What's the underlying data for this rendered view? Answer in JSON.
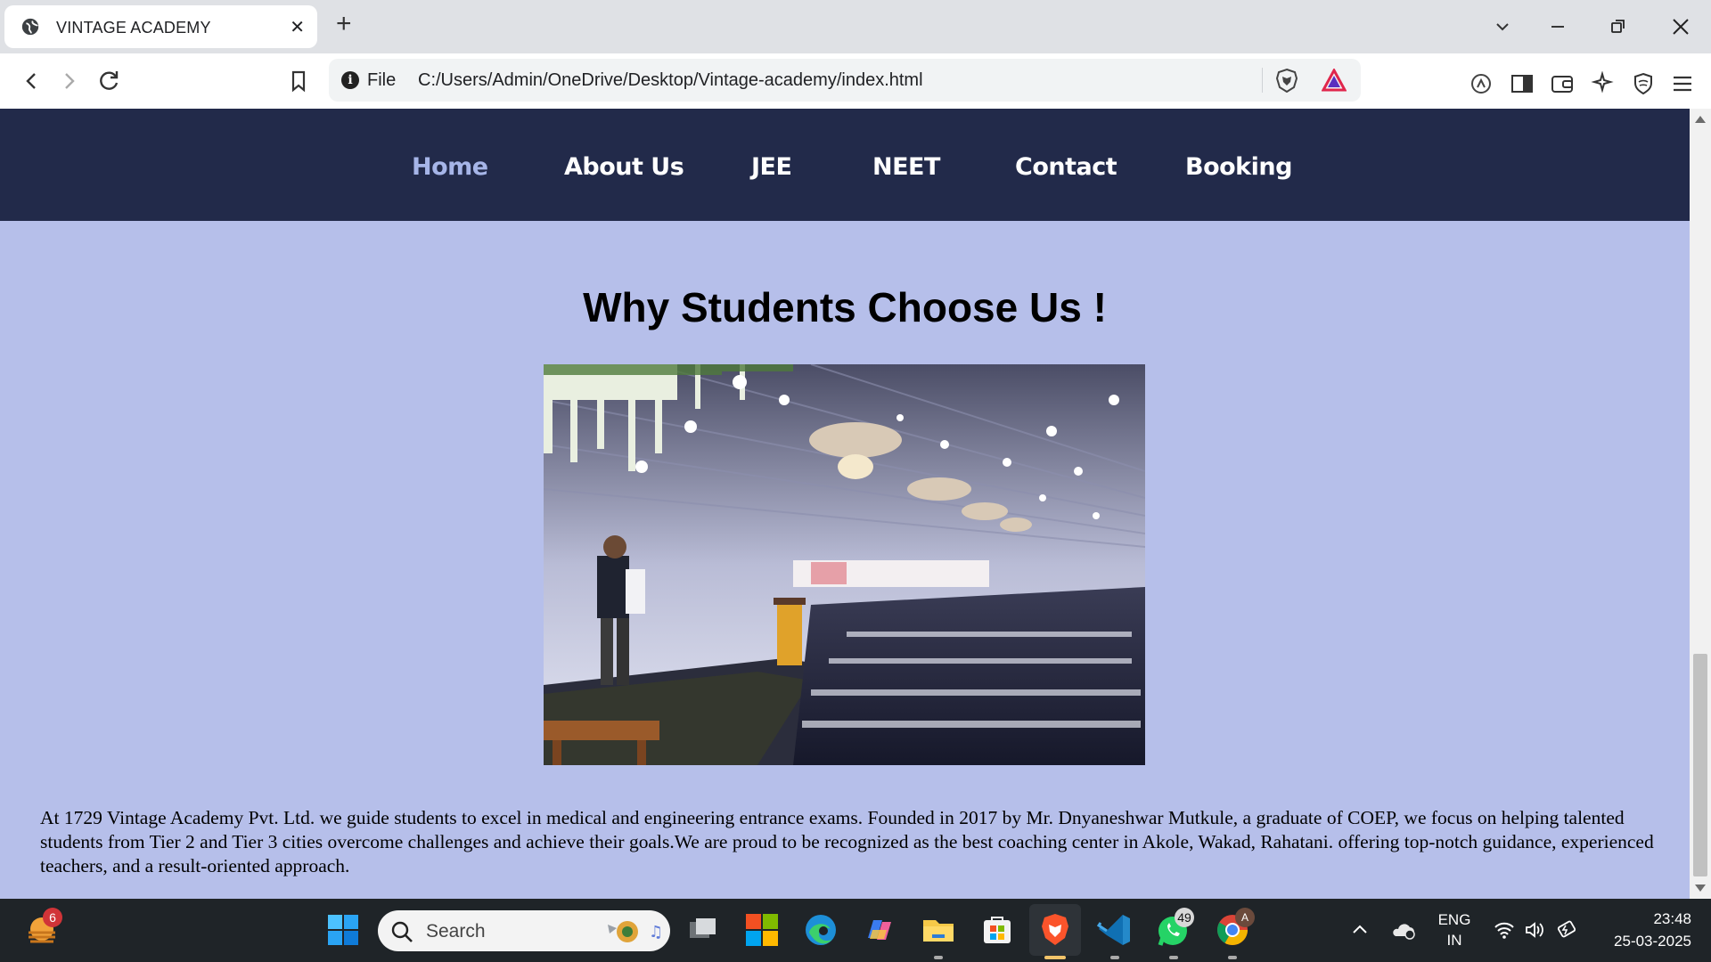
{
  "browser": {
    "tab_title": "VINTAGE ACADEMY",
    "url_scheme_label": "File",
    "url": "C:/Users/Admin/OneDrive/Desktop/Vintage-academy/index.html"
  },
  "site": {
    "nav": [
      "Home",
      "About Us",
      "JEE",
      "NEET",
      "Contact",
      "Booking"
    ],
    "active_nav": "Home",
    "heading": "Why Students Choose Us !",
    "image_alt": "Students gathered under a decorated tent for a seminar",
    "paragraph": "At 1729 Vintage Academy Pvt. Ltd. we guide students to excel in medical and engineering entrance exams. Founded in 2017 by Mr. Dnyaneshwar Mutkule, a graduate of COEP, we focus on helping talented students from Tier 2 and Tier 3 cities overcome challenges and achieve their goals.We are proud to be recognized as the best coaching center in Akole, Wakad, Rahatani. offering top-notch guidance, experienced teachers, and a result-oriented approach."
  },
  "taskbar": {
    "search_placeholder": "Search",
    "widgets_badge": "6",
    "whatsapp_badge": "49",
    "chrome_profile_badge": "A",
    "lang_top": "ENG",
    "lang_bottom": "IN",
    "time": "23:48",
    "date": "25-03-2025"
  },
  "colors": {
    "nav_bg": "#222a4a",
    "page_bg": "#b6bfea",
    "active_link": "#a6b5e8"
  }
}
